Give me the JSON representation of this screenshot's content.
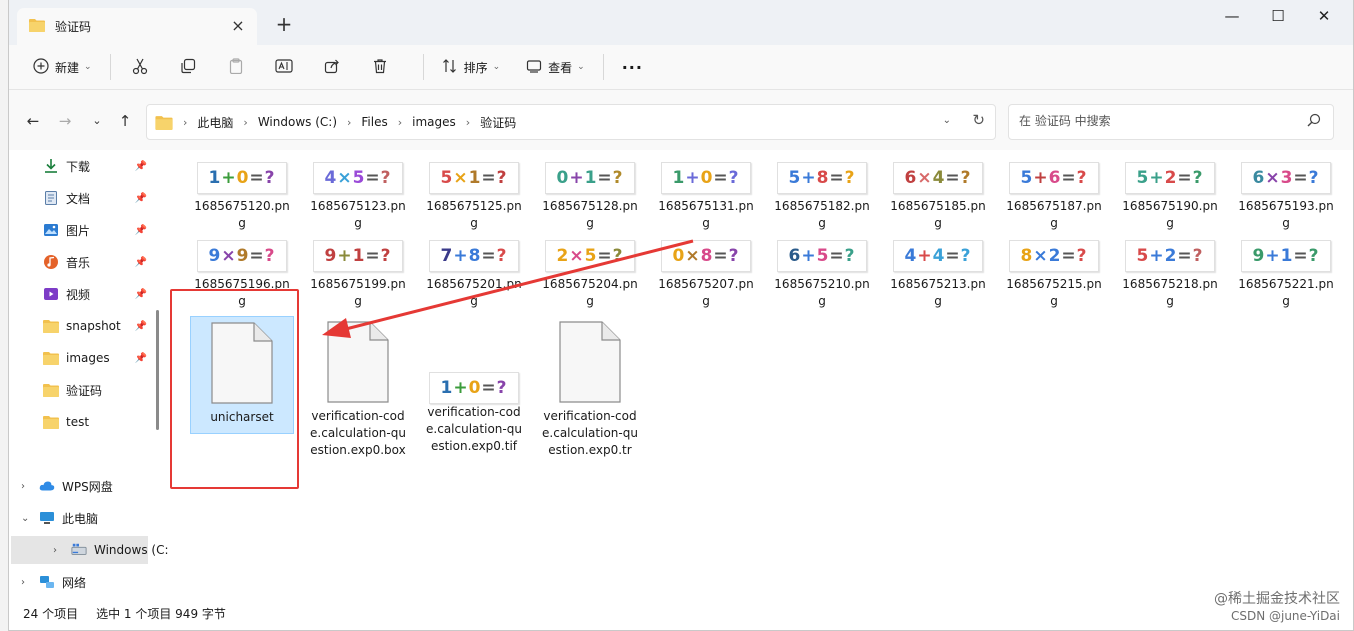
{
  "tab": {
    "title": "验证码",
    "close": "×",
    "new_tab": "+"
  },
  "window_controls": {
    "minimize": "—",
    "maximize": "☐",
    "close": "✕"
  },
  "toolbar": {
    "new_label": "新建",
    "sort_label": "排序",
    "view_label": "查看",
    "more": "···"
  },
  "breadcrumb": [
    "此电脑",
    "Windows (C:)",
    "Files",
    "images",
    "验证码"
  ],
  "search": {
    "placeholder": "在 验证码 中搜索"
  },
  "sidebar": {
    "quick_access": [
      {
        "label": "下载",
        "icon": "download-icon",
        "pinned": true
      },
      {
        "label": "文档",
        "icon": "document-icon",
        "pinned": true
      },
      {
        "label": "图片",
        "icon": "pictures-icon",
        "pinned": true
      },
      {
        "label": "音乐",
        "icon": "music-icon",
        "pinned": true
      },
      {
        "label": "视频",
        "icon": "video-icon",
        "pinned": true
      },
      {
        "label": "snapshot",
        "icon": "folder-icon",
        "pinned": true
      },
      {
        "label": "images",
        "icon": "folder-icon",
        "pinned": true
      },
      {
        "label": "验证码",
        "icon": "folder-icon",
        "pinned": false
      },
      {
        "label": "test",
        "icon": "folder-icon",
        "pinned": false
      }
    ],
    "tree": [
      {
        "label": "WPS网盘",
        "icon": "cloud-icon"
      },
      {
        "label": "此电脑",
        "icon": "computer-icon"
      },
      {
        "label": "Windows (C:",
        "icon": "drive-icon"
      },
      {
        "label": "网络",
        "icon": "network-icon"
      }
    ]
  },
  "files_row1": [
    {
      "name": "1685675120.png",
      "chars": [
        "1",
        "+",
        "0",
        "=",
        "?"
      ],
      "colors": [
        "#2a6fb0",
        "#3b9c3b",
        "#e8a317",
        "#555",
        "#8844aa"
      ]
    },
    {
      "name": "1685675123.png",
      "chars": [
        "4",
        "×",
        "5",
        "=",
        "?"
      ],
      "colors": [
        "#6a6ad8",
        "#3aa1d8",
        "#9a4ad8",
        "#555",
        "#c06060"
      ]
    },
    {
      "name": "1685675125.png",
      "chars": [
        "5",
        "×",
        "1",
        "=",
        "?"
      ],
      "colors": [
        "#d84a4a",
        "#e8a317",
        "#b07a2a",
        "#555",
        "#c04040"
      ]
    },
    {
      "name": "1685675128.png",
      "chars": [
        "0",
        "+",
        "1",
        "=",
        "?"
      ],
      "colors": [
        "#3aa08a",
        "#8844aa",
        "#3aa08a",
        "#555",
        "#b08a2a"
      ]
    },
    {
      "name": "1685675131.png",
      "chars": [
        "1",
        "+",
        "0",
        "=",
        "?"
      ],
      "colors": [
        "#3a9a6a",
        "#6a6ad8",
        "#e8a317",
        "#555",
        "#6a6ad8"
      ]
    },
    {
      "name": "1685675182.png",
      "chars": [
        "5",
        "+",
        "8",
        "=",
        "?"
      ],
      "colors": [
        "#3a7ad8",
        "#3a7ad8",
        "#d84a4a",
        "#555",
        "#e8a317"
      ]
    },
    {
      "name": "1685675185.png",
      "chars": [
        "6",
        "×",
        "4",
        "=",
        "?"
      ],
      "colors": [
        "#c04040",
        "#d86a6a",
        "#8a8a3a",
        "#555",
        "#b07a2a"
      ]
    },
    {
      "name": "1685675187.png",
      "chars": [
        "5",
        "+",
        "6",
        "=",
        "?"
      ],
      "colors": [
        "#3a7ad8",
        "#c04040",
        "#d84a8a",
        "#555",
        "#d84a4a"
      ]
    },
    {
      "name": "1685675190.png",
      "chars": [
        "5",
        "+",
        "2",
        "=",
        "?"
      ],
      "colors": [
        "#3aa08a",
        "#3aa08a",
        "#d84a4a",
        "#555",
        "#3a9a6a"
      ]
    },
    {
      "name": "1685675193.png",
      "chars": [
        "6",
        "×",
        "3",
        "=",
        "?"
      ],
      "colors": [
        "#3a8aa0",
        "#8844aa",
        "#d84a8a",
        "#555",
        "#3a7ad8"
      ]
    }
  ],
  "files_row2": [
    {
      "name": "1685675196.png",
      "chars": [
        "9",
        "×",
        "9",
        "=",
        "?"
      ],
      "colors": [
        "#3a7ad8",
        "#8844aa",
        "#b07a2a",
        "#555",
        "#d84a8a"
      ]
    },
    {
      "name": "1685675199.png",
      "chars": [
        "9",
        "+",
        "1",
        "=",
        "?"
      ],
      "colors": [
        "#c04040",
        "#8a8a3a",
        "#c04040",
        "#555",
        "#c04040"
      ]
    },
    {
      "name": "1685675201.png",
      "chars": [
        "7",
        "+",
        "8",
        "=",
        "?"
      ],
      "colors": [
        "#3a3a8a",
        "#3a7ad8",
        "#3a7ad8",
        "#555",
        "#d84a4a"
      ]
    },
    {
      "name": "1685675204.png",
      "chars": [
        "2",
        "×",
        "5",
        "=",
        "?"
      ],
      "colors": [
        "#e8a317",
        "#d84a8a",
        "#e8a317",
        "#555",
        "#8a8a3a"
      ]
    },
    {
      "name": "1685675207.png",
      "chars": [
        "0",
        "×",
        "8",
        "=",
        "?"
      ],
      "colors": [
        "#e8a317",
        "#b07a2a",
        "#d84a8a",
        "#555",
        "#8844aa"
      ]
    },
    {
      "name": "1685675210.png",
      "chars": [
        "6",
        "+",
        "5",
        "=",
        "?"
      ],
      "colors": [
        "#2a5a8a",
        "#3a7ad8",
        "#d84a8a",
        "#555",
        "#3aa08a"
      ]
    },
    {
      "name": "1685675213.png",
      "chars": [
        "4",
        "+",
        "4",
        "=",
        "?"
      ],
      "colors": [
        "#3a7ad8",
        "#d84a4a",
        "#3aa1d8",
        "#555",
        "#3aa1d8"
      ]
    },
    {
      "name": "1685675215.png",
      "chars": [
        "8",
        "×",
        "2",
        "=",
        "?"
      ],
      "colors": [
        "#e8a317",
        "#3a7ad8",
        "#3a7ad8",
        "#555",
        "#d84a4a"
      ]
    },
    {
      "name": "1685675218.png",
      "chars": [
        "5",
        "+",
        "2",
        "=",
        "?"
      ],
      "colors": [
        "#d84a4a",
        "#3a7ad8",
        "#3a7ad8",
        "#555",
        "#c06060"
      ]
    },
    {
      "name": "1685675221.png",
      "chars": [
        "9",
        "+",
        "1",
        "=",
        "?"
      ],
      "colors": [
        "#3a9a6a",
        "#3a7ad8",
        "#3a7ad8",
        "#555",
        "#3a9a6a"
      ]
    }
  ],
  "files_row3": [
    {
      "name": "unicharset",
      "type": "doc",
      "selected": true
    },
    {
      "name": "verification-code.calculation-question.exp0.box",
      "type": "doc",
      "selected": false
    },
    {
      "name": "verification-code.calculation-question.exp0.tif",
      "type": "image",
      "chars": [
        "1",
        "+",
        "0",
        "=",
        "?"
      ],
      "colors": [
        "#2a6fb0",
        "#3b9c3b",
        "#e8a317",
        "#555",
        "#8844aa"
      ],
      "selected": false
    },
    {
      "name": "verification-code.calculation-question.exp0.tr",
      "type": "doc",
      "selected": false
    }
  ],
  "status": {
    "count": "24 个项目",
    "selection": "选中 1 个项目 949 字节"
  },
  "watermark": {
    "line1": "@稀土掘金技术社区",
    "line2": "CSDN @june-YiDai"
  },
  "colors": {
    "accent": "#0067c0",
    "selection_bg": "#cce8ff",
    "folder": "#f2c14e",
    "annotation_red": "#e53935"
  }
}
